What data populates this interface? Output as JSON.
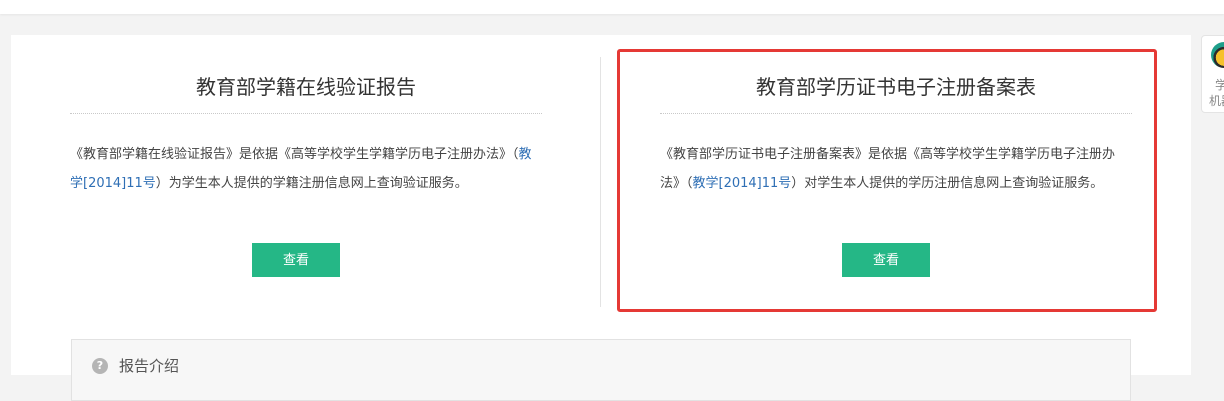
{
  "left_report": {
    "title": "教育部学籍在线验证报告",
    "desc_before": "《教育部学籍在线验证报告》是依据《高等学校学生学籍学历电子注册办法》（",
    "desc_link": "教学[2014]11号",
    "desc_after": "）为学生本人提供的学籍注册信息网上查询验证服务。",
    "button_label": "查看"
  },
  "right_report": {
    "title": "教育部学历证书电子注册备案表",
    "desc_before": "《教育部学历证书电子注册备案表》是依据《高等学校学生学籍学历电子注册办法》（",
    "desc_link": "教学[2014]11号",
    "desc_after": "）对学生本人提供的学历注册信息网上查询验证服务。",
    "button_label": "查看"
  },
  "report_intro": {
    "icon": "question-icon",
    "icon_glyph": "?",
    "label": "报告介绍"
  },
  "side_widget": {
    "icon": "mascot-avatar-icon",
    "line1": "学",
    "line2": "机器"
  },
  "colors": {
    "button": "#25b786",
    "link": "#2f6fb5",
    "highlight": "#e53935"
  }
}
